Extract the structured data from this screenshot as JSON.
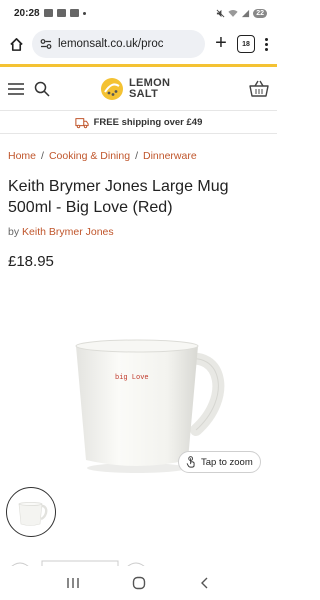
{
  "status_bar": {
    "time": "20:28",
    "notifications": [
      "ebay",
      "ebay",
      "ebay"
    ],
    "battery": "22"
  },
  "browser": {
    "url": "lemonsalt.co.uk/proc",
    "tab_count": "18"
  },
  "site": {
    "brand_line1": "LEMON",
    "brand_line2": "SALT",
    "shipping": "FREE shipping over £49",
    "accent_color": "#f4c233",
    "link_color": "#c0562c"
  },
  "breadcrumb": [
    "Home",
    "Cooking & Dining",
    "Dinnerware"
  ],
  "breadcrumb_sep": "/",
  "product": {
    "title": "Keith Brymer Jones Large Mug 500ml - Big Love (Red)",
    "vendor_prefix": "by",
    "vendor": "Keith Brymer Jones",
    "price": "£18.95",
    "mug_text": "big Love",
    "zoom_label": "Tap to zoom"
  }
}
